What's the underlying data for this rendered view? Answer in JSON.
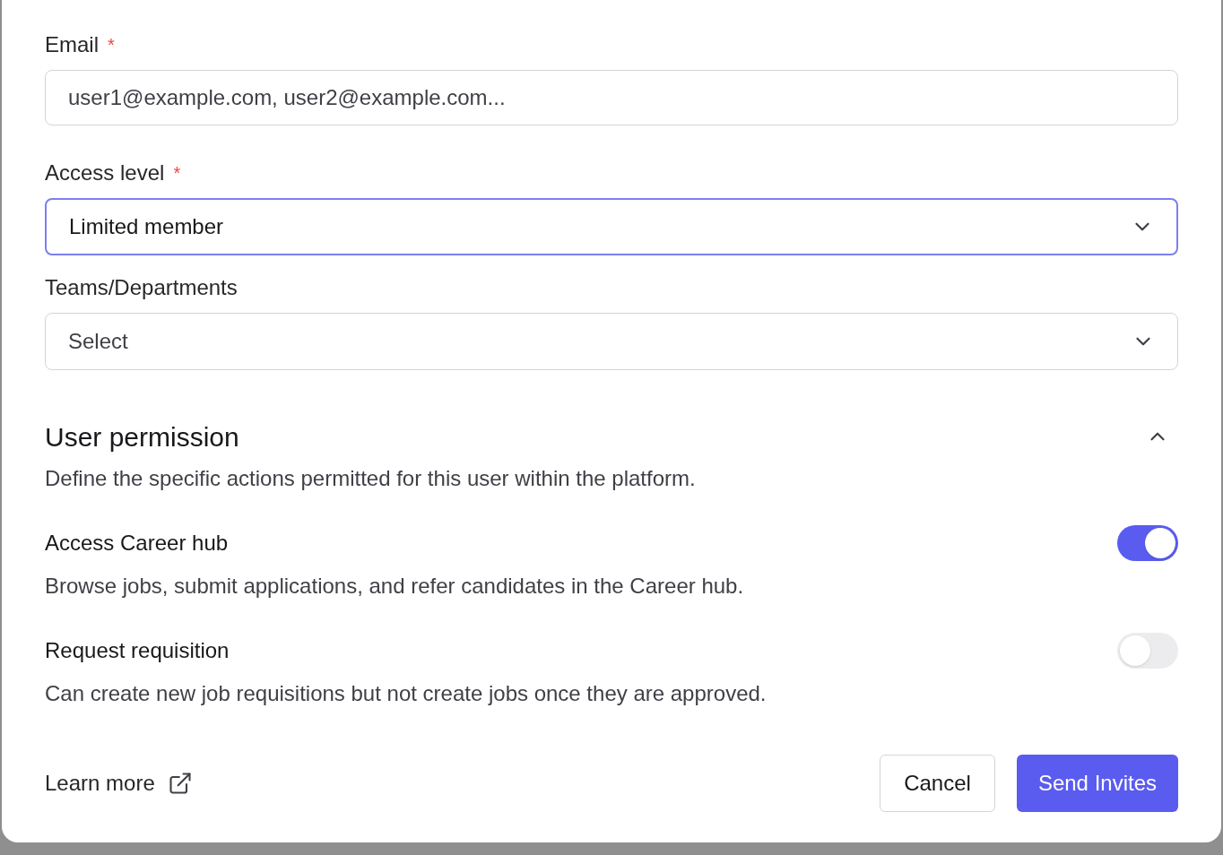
{
  "fields": [
    {
      "kind": "input",
      "label": "Email",
      "required": true,
      "placeholder": "user1@example.com, user2@example.com...",
      "focused": false
    },
    {
      "kind": "select",
      "label": "Access level",
      "required": true,
      "value": "Limited member",
      "focused": true
    },
    {
      "kind": "select",
      "label": "Teams/Departments",
      "required": false,
      "placeholder": "Select",
      "focused": false
    }
  ],
  "required_mark": "*",
  "permission_section": {
    "title": "User permission",
    "expanded": true,
    "description": "Define the specific actions permitted for this user within the platform.",
    "permissions": [
      {
        "title": "Access Career hub",
        "description": "Browse jobs, submit applications, and refer candidates in the Career hub.",
        "on": true
      },
      {
        "title": "Request requisition",
        "description": "Can create new job requisitions but not create jobs once they are approved.",
        "on": false
      }
    ]
  },
  "footer": {
    "link": "Learn more",
    "cancel": "Cancel",
    "submit": "Send Invites"
  }
}
